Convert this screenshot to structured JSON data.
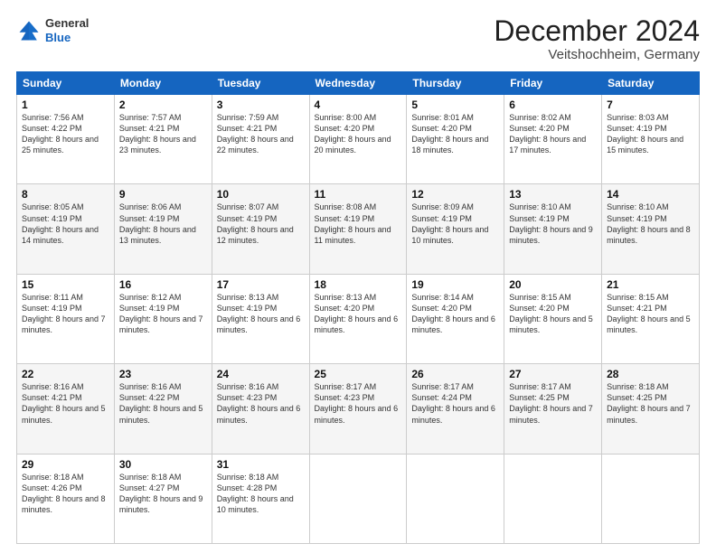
{
  "header": {
    "logo": {
      "general": "General",
      "blue": "Blue"
    },
    "month": "December 2024",
    "location": "Veitshochheim, Germany"
  },
  "days_of_week": [
    "Sunday",
    "Monday",
    "Tuesday",
    "Wednesday",
    "Thursday",
    "Friday",
    "Saturday"
  ],
  "weeks": [
    [
      {
        "day": "1",
        "sunrise": "Sunrise: 7:56 AM",
        "sunset": "Sunset: 4:22 PM",
        "daylight": "Daylight: 8 hours and 25 minutes."
      },
      {
        "day": "2",
        "sunrise": "Sunrise: 7:57 AM",
        "sunset": "Sunset: 4:21 PM",
        "daylight": "Daylight: 8 hours and 23 minutes."
      },
      {
        "day": "3",
        "sunrise": "Sunrise: 7:59 AM",
        "sunset": "Sunset: 4:21 PM",
        "daylight": "Daylight: 8 hours and 22 minutes."
      },
      {
        "day": "4",
        "sunrise": "Sunrise: 8:00 AM",
        "sunset": "Sunset: 4:20 PM",
        "daylight": "Daylight: 8 hours and 20 minutes."
      },
      {
        "day": "5",
        "sunrise": "Sunrise: 8:01 AM",
        "sunset": "Sunset: 4:20 PM",
        "daylight": "Daylight: 8 hours and 18 minutes."
      },
      {
        "day": "6",
        "sunrise": "Sunrise: 8:02 AM",
        "sunset": "Sunset: 4:20 PM",
        "daylight": "Daylight: 8 hours and 17 minutes."
      },
      {
        "day": "7",
        "sunrise": "Sunrise: 8:03 AM",
        "sunset": "Sunset: 4:19 PM",
        "daylight": "Daylight: 8 hours and 15 minutes."
      }
    ],
    [
      {
        "day": "8",
        "sunrise": "Sunrise: 8:05 AM",
        "sunset": "Sunset: 4:19 PM",
        "daylight": "Daylight: 8 hours and 14 minutes."
      },
      {
        "day": "9",
        "sunrise": "Sunrise: 8:06 AM",
        "sunset": "Sunset: 4:19 PM",
        "daylight": "Daylight: 8 hours and 13 minutes."
      },
      {
        "day": "10",
        "sunrise": "Sunrise: 8:07 AM",
        "sunset": "Sunset: 4:19 PM",
        "daylight": "Daylight: 8 hours and 12 minutes."
      },
      {
        "day": "11",
        "sunrise": "Sunrise: 8:08 AM",
        "sunset": "Sunset: 4:19 PM",
        "daylight": "Daylight: 8 hours and 11 minutes."
      },
      {
        "day": "12",
        "sunrise": "Sunrise: 8:09 AM",
        "sunset": "Sunset: 4:19 PM",
        "daylight": "Daylight: 8 hours and 10 minutes."
      },
      {
        "day": "13",
        "sunrise": "Sunrise: 8:10 AM",
        "sunset": "Sunset: 4:19 PM",
        "daylight": "Daylight: 8 hours and 9 minutes."
      },
      {
        "day": "14",
        "sunrise": "Sunrise: 8:10 AM",
        "sunset": "Sunset: 4:19 PM",
        "daylight": "Daylight: 8 hours and 8 minutes."
      }
    ],
    [
      {
        "day": "15",
        "sunrise": "Sunrise: 8:11 AM",
        "sunset": "Sunset: 4:19 PM",
        "daylight": "Daylight: 8 hours and 7 minutes."
      },
      {
        "day": "16",
        "sunrise": "Sunrise: 8:12 AM",
        "sunset": "Sunset: 4:19 PM",
        "daylight": "Daylight: 8 hours and 7 minutes."
      },
      {
        "day": "17",
        "sunrise": "Sunrise: 8:13 AM",
        "sunset": "Sunset: 4:19 PM",
        "daylight": "Daylight: 8 hours and 6 minutes."
      },
      {
        "day": "18",
        "sunrise": "Sunrise: 8:13 AM",
        "sunset": "Sunset: 4:20 PM",
        "daylight": "Daylight: 8 hours and 6 minutes."
      },
      {
        "day": "19",
        "sunrise": "Sunrise: 8:14 AM",
        "sunset": "Sunset: 4:20 PM",
        "daylight": "Daylight: 8 hours and 6 minutes."
      },
      {
        "day": "20",
        "sunrise": "Sunrise: 8:15 AM",
        "sunset": "Sunset: 4:20 PM",
        "daylight": "Daylight: 8 hours and 5 minutes."
      },
      {
        "day": "21",
        "sunrise": "Sunrise: 8:15 AM",
        "sunset": "Sunset: 4:21 PM",
        "daylight": "Daylight: 8 hours and 5 minutes."
      }
    ],
    [
      {
        "day": "22",
        "sunrise": "Sunrise: 8:16 AM",
        "sunset": "Sunset: 4:21 PM",
        "daylight": "Daylight: 8 hours and 5 minutes."
      },
      {
        "day": "23",
        "sunrise": "Sunrise: 8:16 AM",
        "sunset": "Sunset: 4:22 PM",
        "daylight": "Daylight: 8 hours and 5 minutes."
      },
      {
        "day": "24",
        "sunrise": "Sunrise: 8:16 AM",
        "sunset": "Sunset: 4:23 PM",
        "daylight": "Daylight: 8 hours and 6 minutes."
      },
      {
        "day": "25",
        "sunrise": "Sunrise: 8:17 AM",
        "sunset": "Sunset: 4:23 PM",
        "daylight": "Daylight: 8 hours and 6 minutes."
      },
      {
        "day": "26",
        "sunrise": "Sunrise: 8:17 AM",
        "sunset": "Sunset: 4:24 PM",
        "daylight": "Daylight: 8 hours and 6 minutes."
      },
      {
        "day": "27",
        "sunrise": "Sunrise: 8:17 AM",
        "sunset": "Sunset: 4:25 PM",
        "daylight": "Daylight: 8 hours and 7 minutes."
      },
      {
        "day": "28",
        "sunrise": "Sunrise: 8:18 AM",
        "sunset": "Sunset: 4:25 PM",
        "daylight": "Daylight: 8 hours and 7 minutes."
      }
    ],
    [
      {
        "day": "29",
        "sunrise": "Sunrise: 8:18 AM",
        "sunset": "Sunset: 4:26 PM",
        "daylight": "Daylight: 8 hours and 8 minutes."
      },
      {
        "day": "30",
        "sunrise": "Sunrise: 8:18 AM",
        "sunset": "Sunset: 4:27 PM",
        "daylight": "Daylight: 8 hours and 9 minutes."
      },
      {
        "day": "31",
        "sunrise": "Sunrise: 8:18 AM",
        "sunset": "Sunset: 4:28 PM",
        "daylight": "Daylight: 8 hours and 10 minutes."
      },
      null,
      null,
      null,
      null
    ]
  ]
}
